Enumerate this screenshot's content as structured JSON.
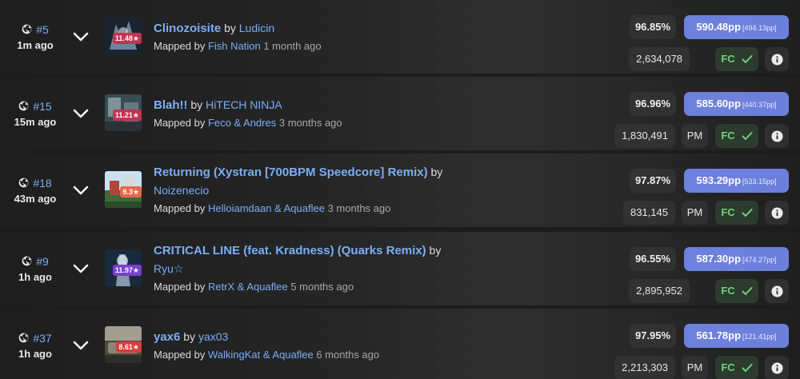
{
  "scores": [
    {
      "rank": "#5",
      "time": "1m ago",
      "title": "Clinozoisite",
      "by": "by",
      "artist": "Ludicin",
      "mapped_by_label": "Mapped by",
      "mapper": "Fish Nation",
      "ago": "1 month ago",
      "stars": "11.48★",
      "star_color": "#c2334f",
      "cover_colors": [
        "#1a2330",
        "#8fa4bf"
      ],
      "accuracy": "96.85%",
      "pp": "590.48pp",
      "raw_pp": "[494.13pp]",
      "score": "2,634,078",
      "pm": "",
      "fc": "FC"
    },
    {
      "rank": "#15",
      "time": "15m ago",
      "title": "Blah!!",
      "by": "by",
      "artist": "HiTECH NINJA",
      "mapped_by_label": "Mapped by",
      "mapper": "Feco & Andres",
      "ago": "3 months ago",
      "stars": "11.21★",
      "star_color": "#c2334f",
      "cover_colors": [
        "#3a4a55",
        "#9bb0b8"
      ],
      "accuracy": "96.96%",
      "pp": "585.60pp",
      "raw_pp": "[440.37pp]",
      "score": "1,830,491",
      "pm": "PM",
      "fc": "FC"
    },
    {
      "rank": "#18",
      "time": "43m ago",
      "title": "Returning (Xystran [700BPM Speedcore] Remix)",
      "by": "by",
      "artist": "Noizenecio",
      "mapped_by_label": "Mapped by",
      "mapper": "Helloiamdaan & Aquaflee",
      "ago": "3 months ago",
      "stars": "9.3★",
      "star_color": "#e8674a",
      "cover_colors": [
        "#3c6a3a",
        "#c9e0f0"
      ],
      "accuracy": "97.87%",
      "pp": "593.29pp",
      "raw_pp": "[533.15pp]",
      "score": "831,145",
      "pm": "PM",
      "fc": "FC"
    },
    {
      "rank": "#9",
      "time": "1h ago",
      "title": "CRITICAL LINE (feat. Kradness) (Quarks Remix)",
      "by": "by",
      "artist": "Ryu☆",
      "mapped_by_label": "Mapped by",
      "mapper": "RetrX & Aquaflee",
      "ago": "5 months ago",
      "stars": "11.97★",
      "star_color": "#7a3fd1",
      "cover_colors": [
        "#182a3d",
        "#b7c7d8"
      ],
      "accuracy": "96.55%",
      "pp": "587.30pp",
      "raw_pp": "[474.27pp]",
      "score": "2,895,952",
      "pm": "",
      "fc": "FC"
    },
    {
      "rank": "#37",
      "time": "1h ago",
      "title": "yax6",
      "by": "by",
      "artist": "yax03",
      "mapped_by_label": "Mapped by",
      "mapper": "WalkingKat & Aquaflee",
      "ago": "6 months ago",
      "stars": "8.61★",
      "star_color": "#d83c3c",
      "cover_colors": [
        "#4a4a42",
        "#c7c2b3"
      ],
      "accuracy": "97.95%",
      "pp": "561.78pp",
      "raw_pp": "[121.41pp]",
      "score": "2,213,303",
      "pm": "PM",
      "fc": "FC"
    }
  ]
}
